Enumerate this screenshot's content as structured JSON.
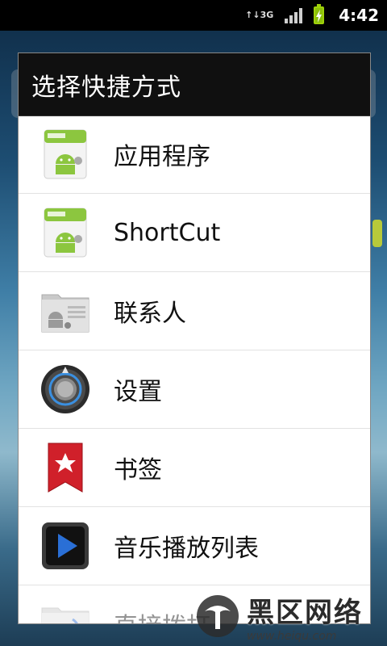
{
  "status_bar": {
    "network_type": "3G",
    "time": "4:42",
    "icons": [
      "data-arrows-icon",
      "signal-icon",
      "battery-charging-icon"
    ]
  },
  "dialog": {
    "title": "选择快捷方式",
    "items": [
      {
        "label": "应用程序",
        "icon": "android-app-icon"
      },
      {
        "label": "ShortCut",
        "icon": "android-app-icon"
      },
      {
        "label": "联系人",
        "icon": "contact-shortcut-icon"
      },
      {
        "label": "设置",
        "icon": "settings-dial-icon"
      },
      {
        "label": "书签",
        "icon": "bookmark-icon"
      },
      {
        "label": "音乐播放列表",
        "icon": "music-play-icon"
      },
      {
        "label": "直接拨打",
        "icon": "direct-dial-icon"
      }
    ]
  },
  "watermark": {
    "name": "黑区网络",
    "url": "www.heiqu.com"
  },
  "colors": {
    "header_bg": "#101010",
    "list_bg": "#ffffff",
    "android_green": "#8cc63f",
    "bookmark_red": "#d0202a",
    "play_blue": "#2a6fd6"
  }
}
